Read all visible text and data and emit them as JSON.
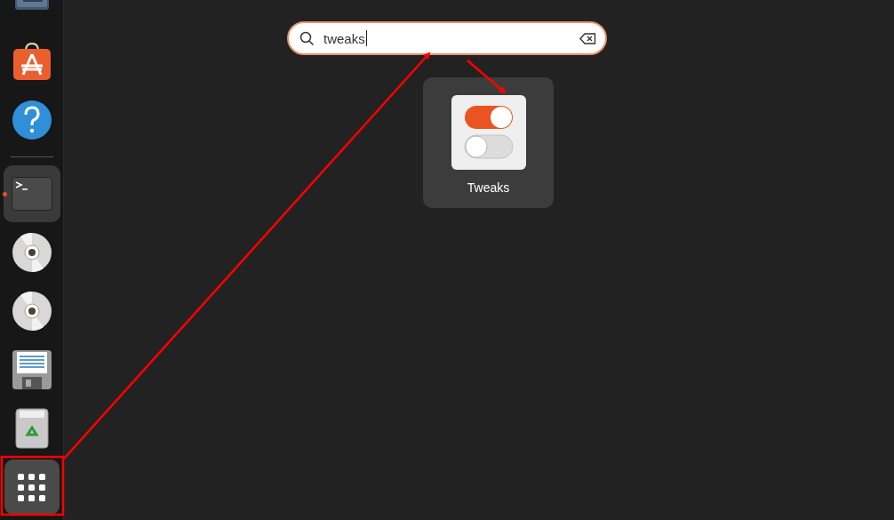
{
  "dock": {
    "top_items": [
      {
        "kind": "drive",
        "running": false
      },
      {
        "kind": "store",
        "running": false
      },
      {
        "kind": "help",
        "running": false
      }
    ],
    "bottom_items": [
      {
        "kind": "terminal",
        "running": true
      },
      {
        "kind": "disc",
        "running": false
      },
      {
        "kind": "disc",
        "running": false
      },
      {
        "kind": "floppy",
        "running": false
      },
      {
        "kind": "trash",
        "running": false
      },
      {
        "kind": "app-grid",
        "running": false
      }
    ]
  },
  "search": {
    "value": "tweaks"
  },
  "results": [
    {
      "label": "Tweaks"
    }
  ]
}
